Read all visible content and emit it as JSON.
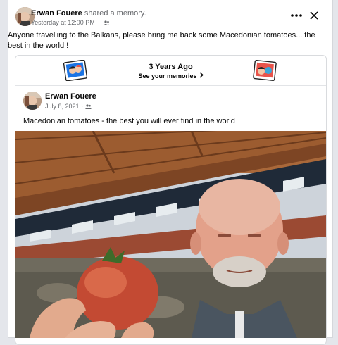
{
  "post": {
    "author": "Erwan Fouere",
    "action": "shared a memory.",
    "timestamp": "Yesterday at 12:00 PM",
    "audience_icon": "friends-icon",
    "text": "Anyone travelling to the Balkans, please bring me back some Macedonian tomatoes... the best in the world !"
  },
  "memory": {
    "title": "3 Years Ago",
    "link": "See your memories",
    "link_icon": "chevron-right-icon",
    "inner_author": "Erwan Fouere",
    "inner_date": "July 8, 2021",
    "inner_text": "Macedonian tomatoes - the best you will ever find in the world"
  },
  "icons": {
    "more": "more-horizontal-icon",
    "close": "close-icon"
  },
  "colors": {
    "secondary_text": "#65676b",
    "primary_text": "#050505",
    "badge_blue": "#1b74e4",
    "badge_red": "#e8534a"
  }
}
